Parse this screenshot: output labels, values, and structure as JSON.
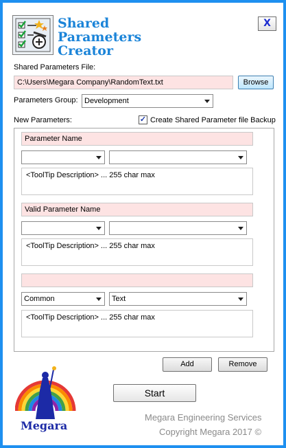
{
  "header": {
    "title_line1": "Shared",
    "title_line2": "Parameters",
    "title_line3": "Creator",
    "close_label": "X"
  },
  "file": {
    "label": "Shared Parameters File:",
    "path": "C:\\Users\\Megara Company\\RandomText.txt",
    "browse_label": "Browse"
  },
  "group": {
    "label": "Parameters Group:",
    "selected": "Development"
  },
  "new_params": {
    "label": "New Parameters:",
    "backup_checked": true,
    "backup_label": "Create Shared Parameter file Backup"
  },
  "params": [
    {
      "name": "Parameter Name",
      "group": "",
      "type": "",
      "tooltip": "<ToolTip Description> ... 255 char max"
    },
    {
      "name": "Valid Parameter Name",
      "group": "",
      "type": "",
      "tooltip": "<ToolTip Description> ... 255 char max"
    },
    {
      "name": "",
      "group": "Common",
      "type": "Text",
      "tooltip": "<ToolTip Description> ... 255 char max"
    }
  ],
  "actions": {
    "add_label": "Add",
    "remove_label": "Remove",
    "start_label": "Start"
  },
  "footer": {
    "logo_text": "Megara",
    "company": "Megara Engineering Services",
    "copyright": "Copyright Megara 2017 ©"
  },
  "colors": {
    "frame": "#1e90f0",
    "title": "#1b84d8",
    "field_bg": "#fde3e3",
    "logo_text": "#1c2aa6"
  }
}
